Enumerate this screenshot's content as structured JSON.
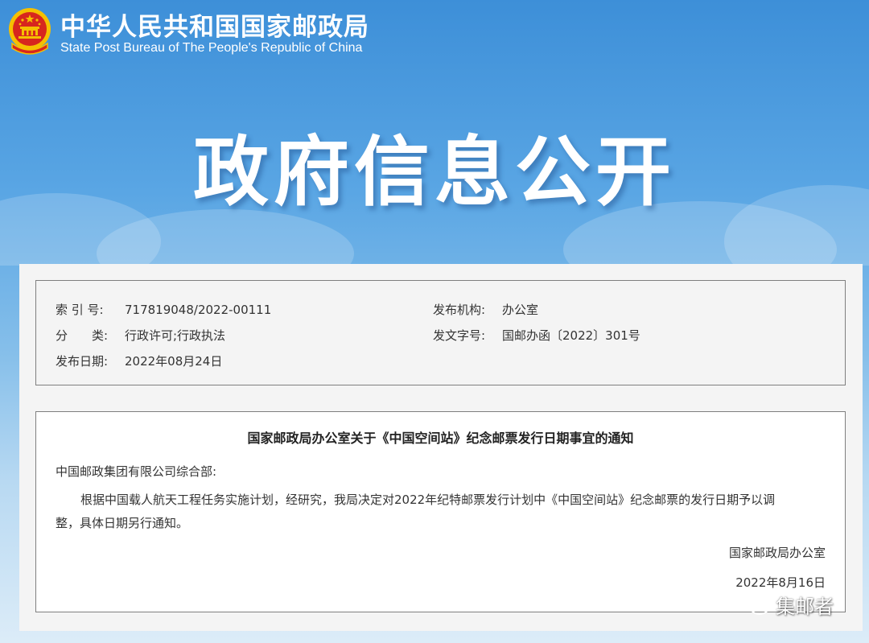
{
  "header": {
    "site_title_cn": "中华人民共和国国家邮政局",
    "site_title_en": "State Post Bureau of The People's Republic of China",
    "banner_title": "政府信息公开",
    "emblem_icon": "national-emblem-icon"
  },
  "meta": {
    "index_no_label": "索 引 号:",
    "index_no_value": "717819048/2022-00111",
    "category_label": "分　　类:",
    "category_value": "行政许可;行政执法",
    "publish_date_label": "发布日期:",
    "publish_date_value": "2022年08月24日",
    "publisher_label": "发布机构:",
    "publisher_value": "办公室",
    "doc_no_label": "发文字号:",
    "doc_no_value": "国邮办函〔2022〕301号"
  },
  "document": {
    "title": "国家邮政局办公室关于《中国空间站》纪念邮票发行日期事宜的通知",
    "recipient": "中国邮政集团有限公司综合部:",
    "body_line1": "根据中国载人航天工程任务实施计划，经研究，我局决定对2022年纪特邮票发行计划中《中国空间站》纪念邮票的发行日期予以调",
    "body_line2": "整，具体日期另行通知。",
    "signature": "国家邮政局办公室",
    "date": "2022年8月16日"
  },
  "watermark": {
    "text": "集邮者",
    "icon": "wechat-icon"
  },
  "colors": {
    "banner_top": "#3d8fd8",
    "banner_bottom": "#dcecf8",
    "emblem_red": "#d7261e",
    "emblem_gold": "#f5c000",
    "panel_bg": "#f4f4f4",
    "border": "#7f7f7f"
  }
}
